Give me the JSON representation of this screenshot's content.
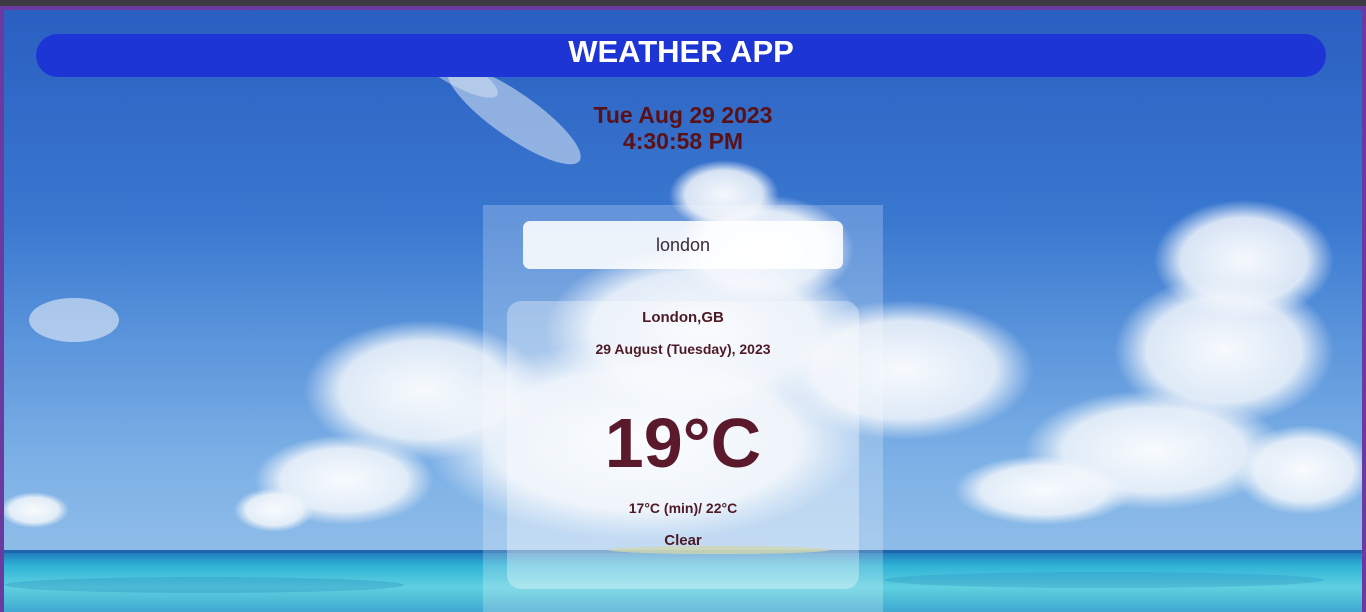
{
  "header": {
    "title": "WEATHER APP"
  },
  "clock": {
    "date": "Tue Aug 29 2023",
    "time": "4:30:58 PM"
  },
  "search": {
    "value": "london"
  },
  "weather": {
    "location": "London,GB",
    "date": "29 August (Tuesday), 2023",
    "temperature": "19°C",
    "min_max": "17°C (min)/ 22°C",
    "condition": "Clear"
  },
  "colors": {
    "header_bg": "#1d35d5",
    "header_text": "#ffffff",
    "datetime_text": "#5a1116",
    "card_text": "#4d1a25"
  }
}
